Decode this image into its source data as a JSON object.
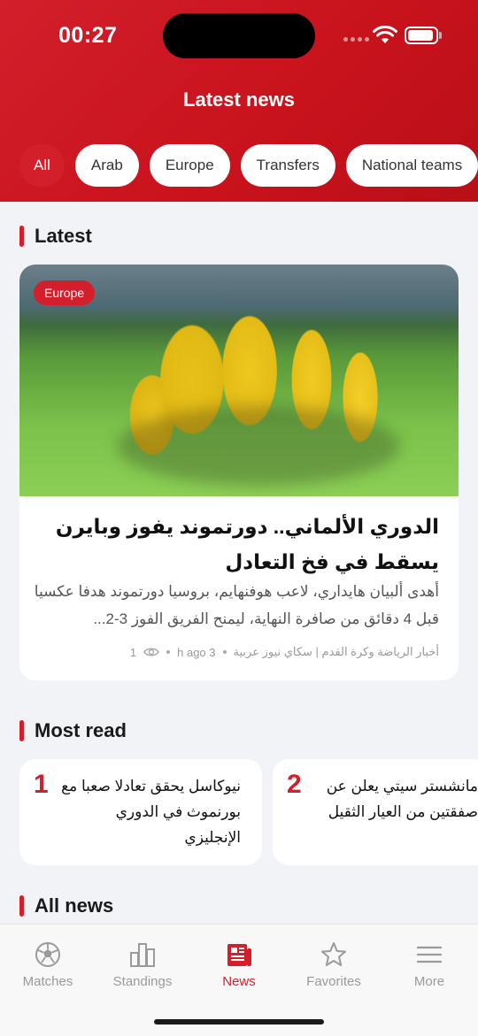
{
  "status_bar": {
    "time": "00:27"
  },
  "header": {
    "title": "Latest news",
    "filters": [
      "All",
      "Arab",
      "Europe",
      "Transfers",
      "National teams"
    ],
    "active_filter": "All"
  },
  "sections": {
    "latest": "Latest",
    "most_read": "Most read",
    "all_news": "All news"
  },
  "featured": {
    "badge": "Europe",
    "title": "الدوري الألماني.. دورتموند يفوز وبايرن يسقط في فخ التعادل",
    "summary": "أهدى ألبيان هايداري، لاعب هوفنهايم، بروسيا دورتموند هدفا عكسيا قبل 4 دقائق من صافرة النهاية، ليمنح الفريق الفوز 3-2...",
    "source": "أخبار الرياضة وكرة القدم | سكاي نيوز عربية",
    "time_ago": "3 h ago",
    "views": "1"
  },
  "most_read": [
    {
      "rank": "1",
      "title": "نيوكاسل يحقق تعادلا صعبا مع بورنموث في الدوري الإنجليزي"
    },
    {
      "rank": "2",
      "title": "مانشستر سيتي يعلن عن صفقتين من العيار الثقيل"
    }
  ],
  "bottom_nav": {
    "items": [
      {
        "label": "Matches",
        "icon": "soccer-ball-icon"
      },
      {
        "label": "Standings",
        "icon": "bar-chart-icon"
      },
      {
        "label": "News",
        "icon": "newspaper-icon"
      },
      {
        "label": "Favorites",
        "icon": "star-icon"
      },
      {
        "label": "More",
        "icon": "menu-icon"
      }
    ],
    "active": "News"
  },
  "colors": {
    "accent": "#d21f2b",
    "background": "#f2f3f6"
  }
}
